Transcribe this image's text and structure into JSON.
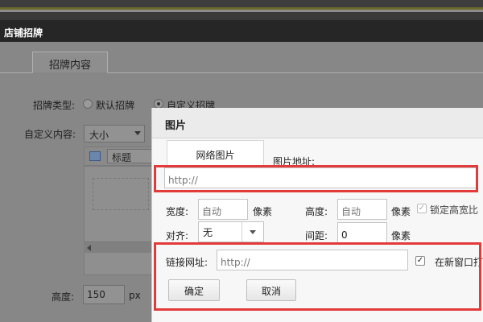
{
  "background": {
    "panel_title": "店铺招牌",
    "tab_label": "招牌内容",
    "sign_type_label": "招牌类型:",
    "option_default": "默认招牌",
    "option_custom": "自定义招牌",
    "custom_content_label": "自定义内容:",
    "size_select_value": "大小",
    "heading_select_value": "标题",
    "height_label": "高度:",
    "height_value": "150",
    "height_unit": "px"
  },
  "dialog": {
    "title": "图片",
    "tab_network": "网络图片",
    "image_url_label": "图片地址:",
    "image_url_placeholder": "http://",
    "width_label": "宽度:",
    "width_placeholder": "自动",
    "width_unit": "像素",
    "height_label": "高度:",
    "height_placeholder": "自动",
    "height_unit": "像素",
    "lock_ratio_label": "锁定高宽比",
    "align_label": "对齐:",
    "align_value": "无",
    "spacing_label": "间距:",
    "spacing_value": "0",
    "spacing_unit": "像素",
    "link_url_label": "链接网址:",
    "link_url_placeholder": "http://",
    "new_window_label": "在新窗口打",
    "confirm_button": "确定",
    "cancel_button": "取消"
  },
  "colors": {
    "highlight": "#e33a3a",
    "overlay": "#878787",
    "title_bar": "#262626"
  }
}
